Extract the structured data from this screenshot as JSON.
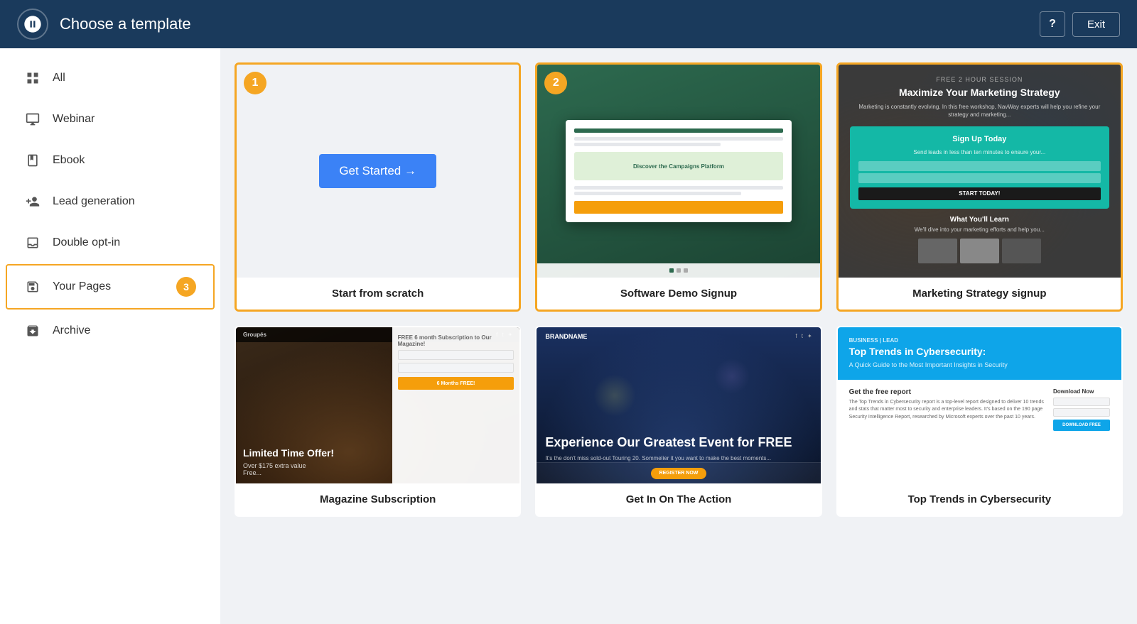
{
  "header": {
    "title": "Choose a template",
    "help_label": "?",
    "exit_label": "Exit"
  },
  "sidebar": {
    "items": [
      {
        "id": "all",
        "label": "All",
        "icon": "grid-icon",
        "selected": false
      },
      {
        "id": "webinar",
        "label": "Webinar",
        "icon": "monitor-icon",
        "selected": false
      },
      {
        "id": "ebook",
        "label": "Ebook",
        "icon": "book-icon",
        "selected": false
      },
      {
        "id": "lead-generation",
        "label": "Lead generation",
        "icon": "person-add-icon",
        "selected": false
      },
      {
        "id": "double-opt-in",
        "label": "Double opt-in",
        "icon": "inbox-icon",
        "selected": false
      },
      {
        "id": "your-pages",
        "label": "Your Pages",
        "icon": "save-icon",
        "selected": true,
        "badge": "3"
      },
      {
        "id": "archive",
        "label": "Archive",
        "icon": "archive-icon",
        "selected": false
      }
    ]
  },
  "templates": {
    "cards": [
      {
        "id": "scratch",
        "label": "Start from scratch",
        "type": "scratch",
        "badge": "1",
        "selected": true,
        "cta": "Get Started →"
      },
      {
        "id": "software-demo",
        "label": "Software Demo Signup",
        "type": "software",
        "badge": "2",
        "selected": true
      },
      {
        "id": "marketing-strategy",
        "label": "Marketing Strategy signup",
        "type": "strategy",
        "selected": true
      },
      {
        "id": "magazine",
        "label": "Magazine Subscription",
        "type": "magazine",
        "selected": false
      },
      {
        "id": "event",
        "label": "Get In On The Action",
        "type": "event",
        "selected": false
      },
      {
        "id": "cybersecurity",
        "label": "Top Trends in Cybersecurity",
        "type": "cyber",
        "selected": false
      }
    ]
  }
}
